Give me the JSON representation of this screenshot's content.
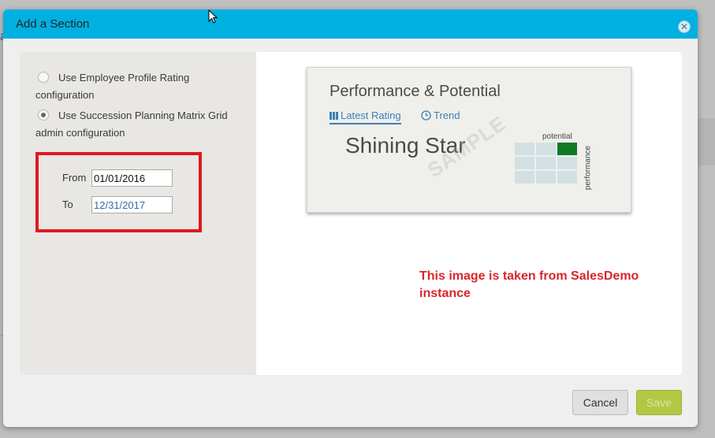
{
  "background": {
    "link_fragment": "a"
  },
  "dialog": {
    "title": "Add a Section",
    "close_icon": "close-icon",
    "options": [
      {
        "label": "Use Employee Profile Rating configuration",
        "selected": false
      },
      {
        "label": "Use Succession Planning Matrix Grid admin configuration",
        "selected": true
      }
    ],
    "date_range": {
      "from_label": "From",
      "from_value": "01/01/2016",
      "to_label": "To",
      "to_value": "12/31/2017"
    },
    "preview": {
      "title": "Performance & Potential",
      "tabs": [
        {
          "label": "Latest Rating",
          "icon": "grid-icon",
          "active": true
        },
        {
          "label": "Trend",
          "icon": "clock-icon",
          "active": false
        }
      ],
      "rating": "Shining Star",
      "watermark": "SAMPLE",
      "potential_label": "potential",
      "performance_label": "performance",
      "highlight_color": "#0f7a24"
    },
    "note": "This image is taken from SalesDemo instance",
    "buttons": {
      "cancel": "Cancel",
      "save": "Save"
    }
  },
  "colors": {
    "header": "#00b0e0",
    "highlight_box": "#e0191f",
    "note_text": "#d9262c",
    "save_button": "#b2c844"
  }
}
